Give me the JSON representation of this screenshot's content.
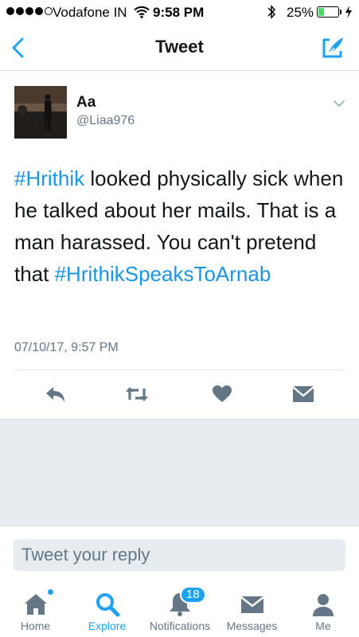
{
  "status_bar": {
    "carrier": "Vodafone IN",
    "time": "9:58 PM",
    "battery_percent": "25%",
    "battery_level": 0.25,
    "signal_bars": 4,
    "signal_total": 5
  },
  "nav": {
    "title": "Tweet"
  },
  "tweet": {
    "author_name": "Aa",
    "author_handle": "@Liaa976",
    "text_parts": [
      {
        "text": "#Hrithik",
        "hashtag": true
      },
      {
        "text": " looked physically sick when he talked about her mails. That is a man harassed. You can't pretend that ",
        "hashtag": false
      },
      {
        "text": "#HrithikSpeaksToArnab",
        "hashtag": true
      }
    ],
    "timestamp": "07/10/17, 9:57 PM"
  },
  "reply": {
    "placeholder": "Tweet your reply"
  },
  "tab_bar": {
    "items": [
      {
        "label": "Home",
        "icon": "home-icon"
      },
      {
        "label": "Explore",
        "icon": "search-icon"
      },
      {
        "label": "Notifications",
        "icon": "bell-icon",
        "badge": "18"
      },
      {
        "label": "Messages",
        "icon": "envelope-icon"
      },
      {
        "label": "Me",
        "icon": "person-icon"
      }
    ],
    "active": "Explore"
  },
  "colors": {
    "accent": "#1da1f2",
    "hashtag": "#1b95e0",
    "icon_gray": "#657786",
    "background_gray": "#e6ecf0"
  }
}
